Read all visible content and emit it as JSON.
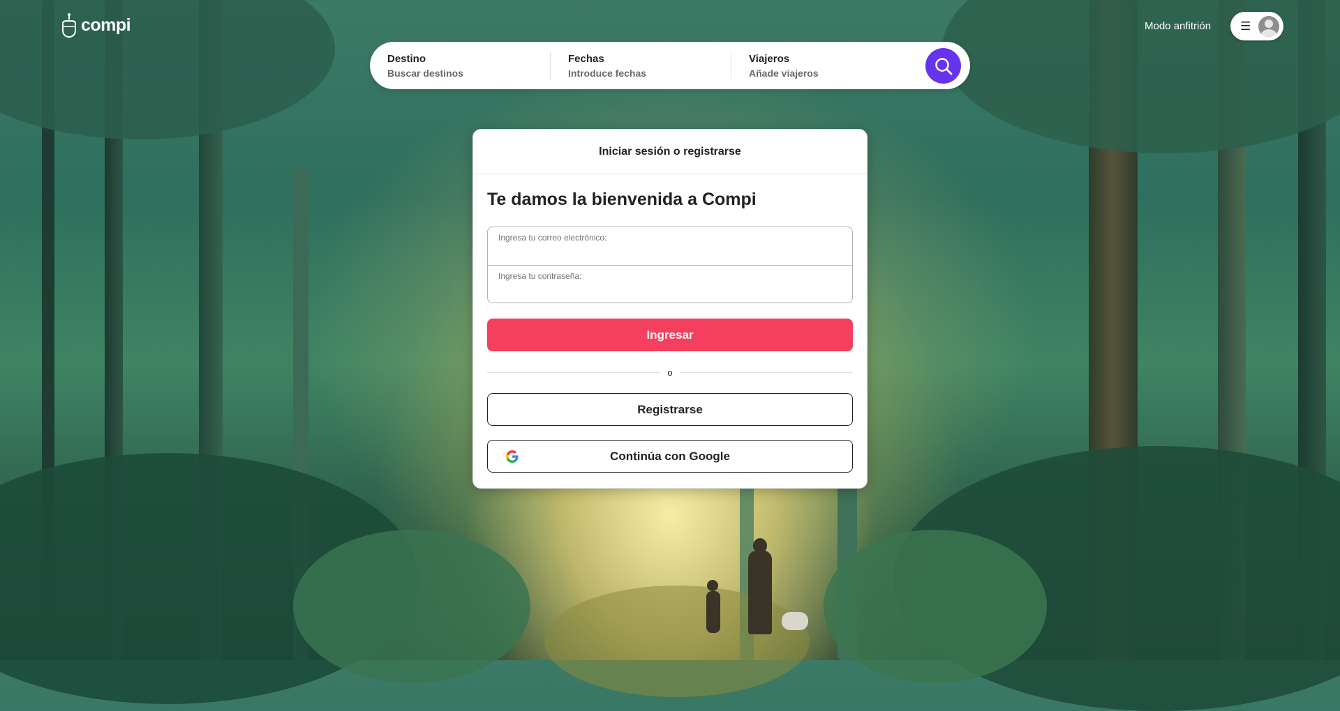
{
  "brand": {
    "name": "compi"
  },
  "header": {
    "host_mode_label": "Modo anfitrión",
    "menu_icon": "hamburger-icon",
    "avatar_icon": "user-avatar-icon"
  },
  "search": {
    "destination": {
      "title": "Destino",
      "placeholder": "Buscar destinos"
    },
    "dates": {
      "title": "Fechas",
      "placeholder": "Introduce fechas"
    },
    "travelers": {
      "title": "Viajeros",
      "placeholder": "Añade viajeros"
    },
    "button_icon": "search-icon",
    "accent_color": "#6633ee"
  },
  "modal": {
    "header_title": "Iniciar sesión o registrarse",
    "welcome_title": "Te damos la bienvenida a Compi",
    "email_label": "Ingresa tu correo electrónico:",
    "email_value": "",
    "password_label": "Ingresa tu contraseña:",
    "password_value": "",
    "login_button": "Ingresar",
    "login_color": "#f43f5e",
    "or_text": "o",
    "register_button": "Registrarse",
    "google_button": "Continúa con Google",
    "google_icon": "google-icon"
  }
}
